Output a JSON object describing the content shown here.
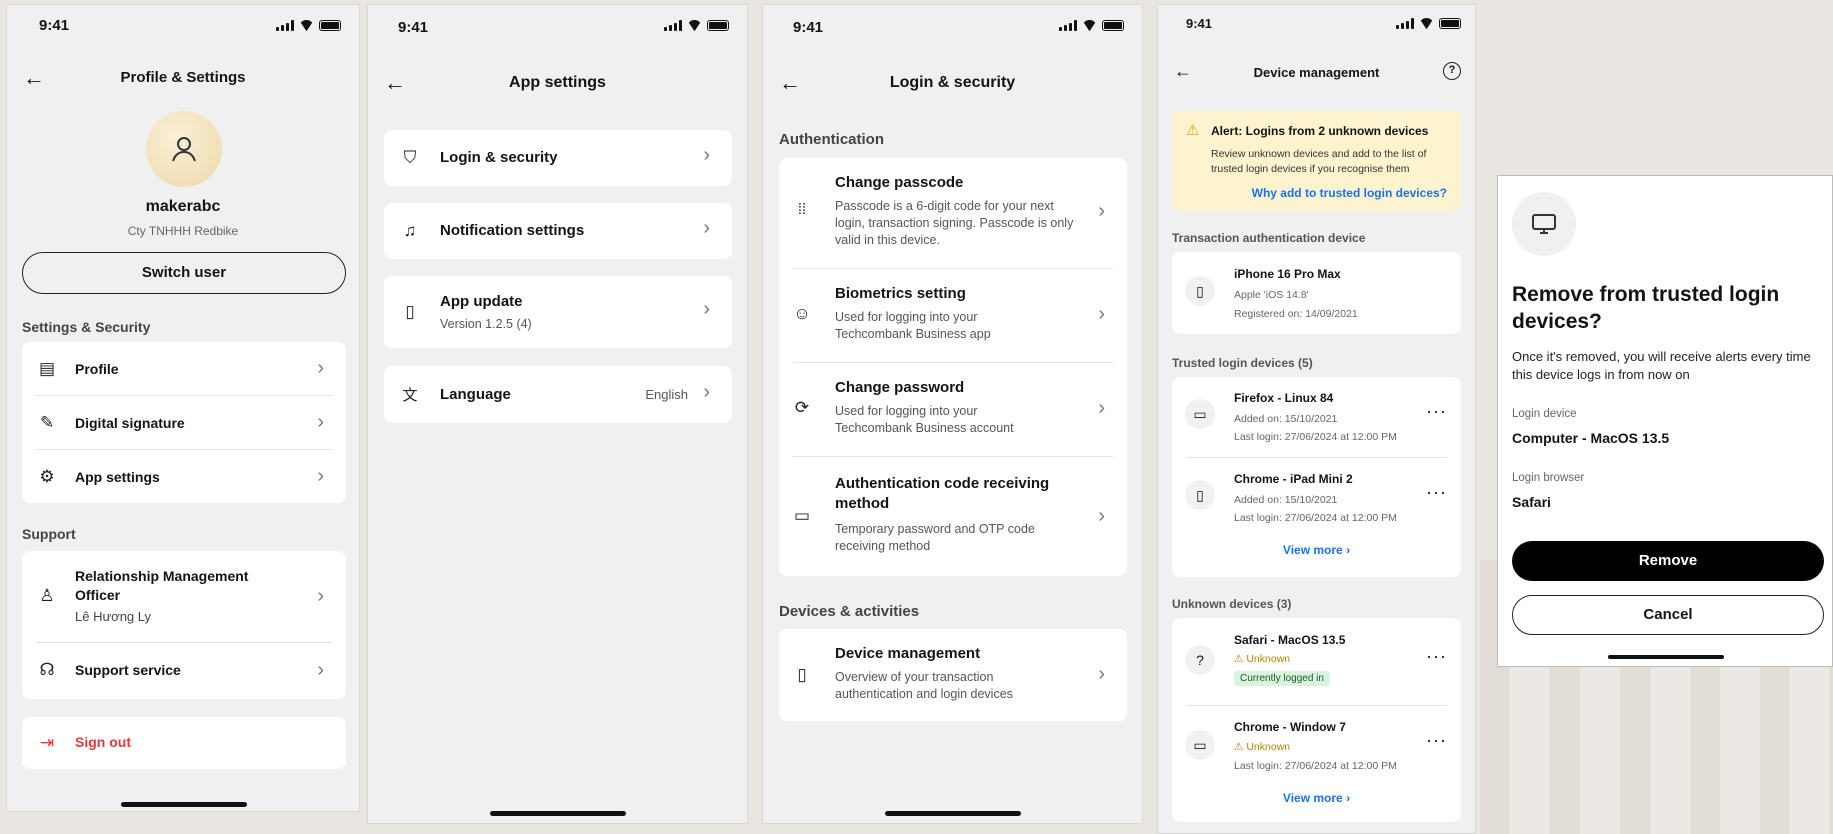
{
  "status_time": "9:41",
  "s1": {
    "title": "Profile & Settings",
    "username": "makerabc",
    "company": "Cty TNHHH Redbike",
    "switch_user": "Switch user",
    "section1": "Settings & Security",
    "items": [
      "Profile",
      "Digital signature",
      "App settings"
    ],
    "section2": "Support",
    "rm_title": "Relationship Management Officer",
    "rm_name": "Lê Hương Ly",
    "support": "Support service",
    "signout": "Sign out"
  },
  "s2": {
    "title": "App settings",
    "login": "Login & security",
    "notif": "Notification settings",
    "update": "App update",
    "version": "Version 1.2.5 (4)",
    "lang": "Language",
    "lang_value": "English"
  },
  "s3": {
    "title": "Login & security",
    "section1": "Authentication",
    "passcode": "Change passcode",
    "passcode_desc": "Passcode is a 6-digit code for your next login, transaction signing. Passcode is only valid in this device.",
    "bio": "Biometrics setting",
    "bio_desc": "Used for logging into your Techcombank Business app",
    "pwd": "Change password",
    "pwd_desc": "Used for logging into your Techcombank Business account",
    "auth": "Authentication code receiving method",
    "auth_desc": "Temporary password and OTP code receiving method",
    "section2": "Devices & activities",
    "devmgmt": "Device management",
    "devmgmt_desc": "Overview of your transaction authentication and login devices"
  },
  "s4": {
    "title": "Device management",
    "alert_title": "Alert: Logins from 2 unknown devices",
    "alert_desc": "Review unknown devices and add to the list of trusted login devices if you recognise them",
    "alert_link": "Why add to trusted login devices?",
    "sec_tx": "Transaction authentication device",
    "tx_name": "iPhone 16 Pro Max",
    "tx_os": "Apple 'iOS 14.8'",
    "tx_reg": "Registered on: 14/09/2021",
    "sec_trusted": "Trusted login devices (5)",
    "t1_name": "Firefox - Linux 84",
    "t1_added": "Added on: 15/10/2021",
    "t1_last": "Last login: 27/06/2024 at 12:00 PM",
    "t2_name": "Chrome - iPad Mini 2",
    "t2_added": "Added on: 15/10/2021",
    "t2_last": "Last login: 27/06/2024 at 12:00 PM",
    "view_more": "View more",
    "sec_unknown": "Unknown devices (3)",
    "u1_name": "Safari - MacOS 13.5",
    "unknown": "Unknown",
    "u1_badge": "Currently logged in",
    "u2_name": "Chrome - Window 7",
    "u2_last": "Last login: 27/06/2024 at 12:00 PM"
  },
  "s5": {
    "title": "Remove from trusted login devices?",
    "desc": "Once it's removed, you will receive alerts every time this device logs in from now on",
    "dev_label": "Login device",
    "dev_value": "Computer - MacOS 13.5",
    "br_label": "Login browser",
    "br_value": "Safari",
    "remove": "Remove",
    "cancel": "Cancel"
  }
}
